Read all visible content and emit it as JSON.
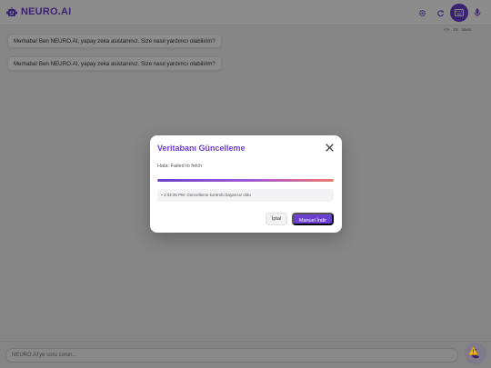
{
  "app": {
    "title": "NEURO.AI"
  },
  "header": {
    "icons": [
      "settings-icon",
      "refresh-icon",
      "keyboard-icon",
      "microphone-icon"
    ],
    "token_count": "19",
    "token_label": "token",
    "accent": "#6b3fd0"
  },
  "chat": {
    "messages": [
      {
        "text": "Merhaba! Ben NEURO.AI, yapay zeka asistanınız. Size nasıl yardımcı olabilirim?"
      },
      {
        "text": "Merhaba! Ben NEURO.AI, yapay zeka asistanınız. Size nasıl yardımcı olabilirim?"
      }
    ],
    "input_placeholder": "NEURO.AI'ye soru sorun..."
  },
  "modal": {
    "title": "Veritabanı Güncelleme",
    "error": "Hata: Failed to fetch",
    "progress": 1.0,
    "log_entry": "• 1:03:35 PM: Güncelleme kontrolü başarısız oldu",
    "cancel_label": "İptal",
    "primary_label": "Manuel İndir"
  }
}
